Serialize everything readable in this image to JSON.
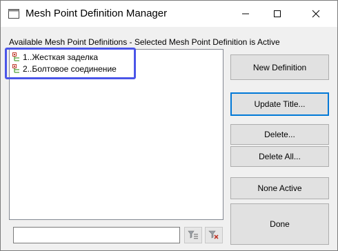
{
  "window": {
    "title": "Mesh Point Definition Manager"
  },
  "list": {
    "label": "Available Mesh Point Definitions - Selected Mesh Point Definition is Active",
    "items": [
      {
        "label": "1..Жесткая заделка",
        "icon": "mesh-point-definition-icon"
      },
      {
        "label": "2..Болтовое соединение",
        "icon": "mesh-point-definition-icon"
      }
    ]
  },
  "buttons": {
    "new_definition": "New Definition",
    "update_title": "Update Title...",
    "delete": "Delete...",
    "delete_all": "Delete All...",
    "none_active": "None Active",
    "done": "Done"
  },
  "filter": {
    "value": "",
    "filter_icon": "filter-icon",
    "clear_filter_icon": "clear-filter-icon"
  },
  "colors": {
    "highlight": "#4a55e8",
    "focus": "#0078d7"
  }
}
